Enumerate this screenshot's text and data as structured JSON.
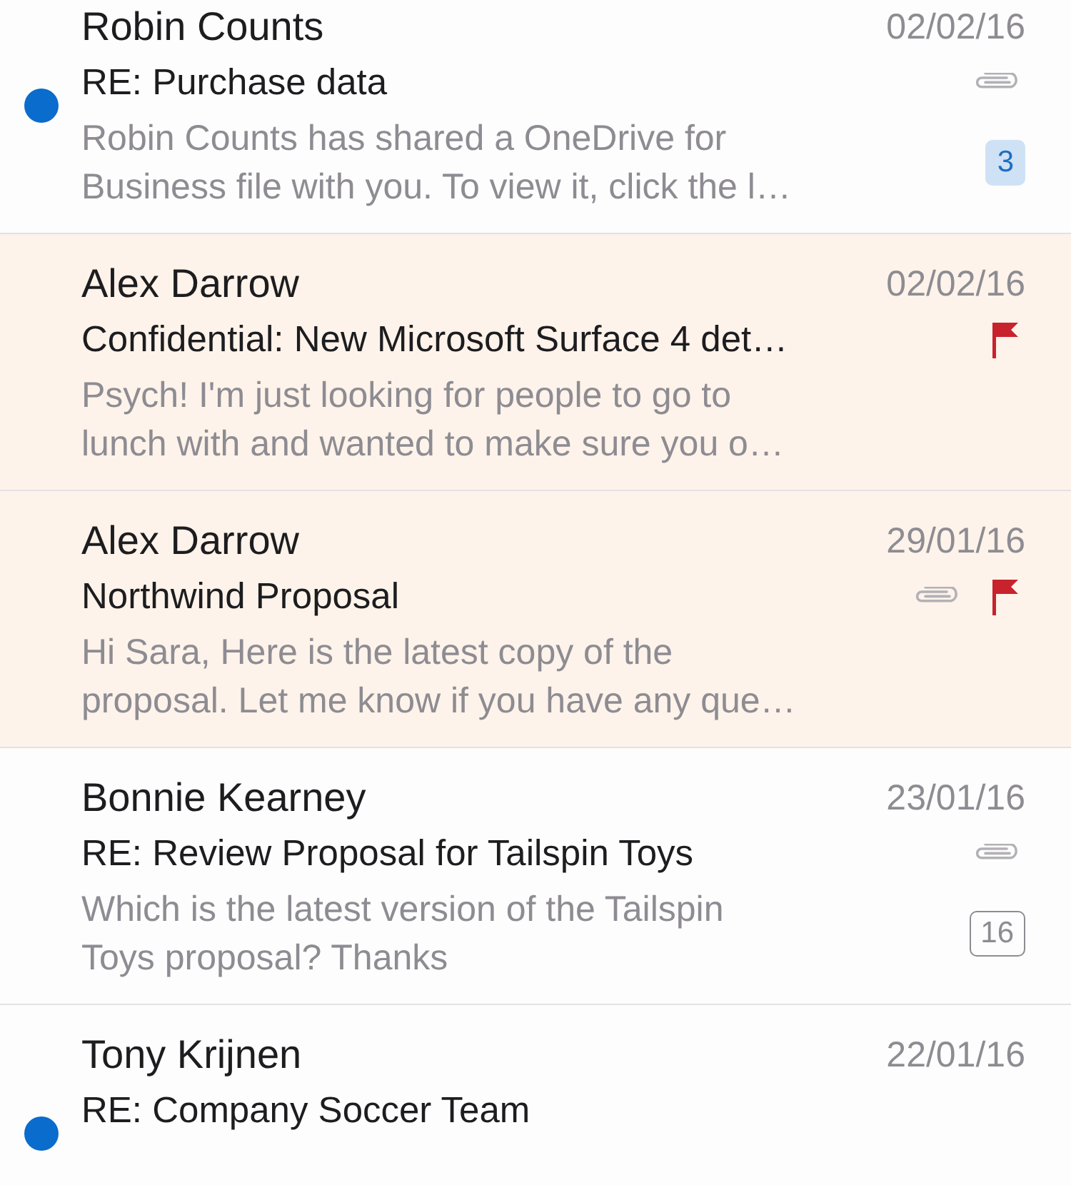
{
  "messages": [
    {
      "sender": "Robin Counts",
      "date": "02/02/16",
      "subject": "RE: Purchase data",
      "preview": [
        "Robin Counts has shared a OneDrive for",
        "Business file with you. To view it, click the l…"
      ],
      "unread": true,
      "flagged": false,
      "attachment": true,
      "count": "3"
    },
    {
      "sender": "Alex Darrow",
      "date": "02/02/16",
      "subject": "Confidential: New Microsoft Surface 4 det…",
      "preview": [
        "Psych! I'm just looking for people to go to",
        "lunch with and wanted to make sure you o…"
      ],
      "unread": false,
      "flagged": true,
      "attachment": false
    },
    {
      "sender": "Alex Darrow",
      "date": "29/01/16",
      "subject": "Northwind Proposal",
      "preview": [
        "Hi Sara, Here is the latest copy of the",
        "proposal. Let me know if you have any que…"
      ],
      "unread": false,
      "flagged": true,
      "attachment": true
    },
    {
      "sender": "Bonnie Kearney",
      "date": "23/01/16",
      "subject": "RE: Review Proposal for Tailspin Toys",
      "preview": [
        "Which is the latest version of the Tailspin",
        "Toys proposal? Thanks"
      ],
      "unread": false,
      "flagged": false,
      "attachment": true,
      "count": "16"
    },
    {
      "sender": "Tony Krijnen",
      "date": "22/01/16",
      "subject": "RE: Company Soccer Team",
      "unread": true,
      "flagged": false,
      "attachment": false
    }
  ]
}
